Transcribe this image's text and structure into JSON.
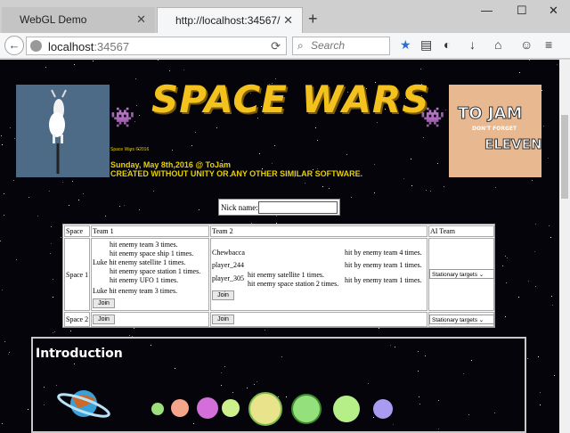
{
  "tabs": [
    {
      "label": "WebGL Demo"
    },
    {
      "label": "http://localhost:34567/"
    }
  ],
  "nav": {
    "url_host": "localhost",
    "url_port": ":34567",
    "search_placeholder": "Search"
  },
  "header": {
    "title": "SPACE WARS",
    "copyright": "Space Wars ©2016",
    "date_line": "Sunday, May 8th,2016 @ ToJam",
    "created_line": "CREATED WITHOUT UNITY OR ANY OTHER SIMILAR SOFTWARE.",
    "tojam_line1": "TO JAM",
    "tojam_line2": "DON'T FORGET",
    "tojam_line3": "ELEVEN"
  },
  "nick": {
    "label": "Nick name:",
    "value": ""
  },
  "game_table": {
    "headers": [
      "Space",
      "Team 1",
      "Team 2",
      "AI Team"
    ],
    "space1": "Space 1",
    "space2": "Space 2",
    "team1_lines": [
      "hit enemy team 3 times.",
      "hit enemy space ship 1 times.",
      "Luke hit enemy satellite 1 times.",
      "hit enemy space station 1 times.",
      "hit enemy UFO 1 times.",
      "Luke hit enemy team 3 times."
    ],
    "team2_players": [
      "Chewbacca",
      "player_244",
      "player_305"
    ],
    "team2_mid_lines": [
      "hit enemy satellite 1 times.",
      "hit enemy space station 2 times."
    ],
    "team2_right_lines": [
      "hit by enemy team 4 times.",
      "hit by enemy team 1 times.",
      "hit by enemy team 1 times."
    ],
    "join_label": "Join",
    "ai_option": "Stationary targets"
  },
  "intro": {
    "heading": "Introduction"
  },
  "colors": {
    "title": "#f4c21e",
    "subtitle": "#e8d000",
    "background": "#04040a"
  }
}
